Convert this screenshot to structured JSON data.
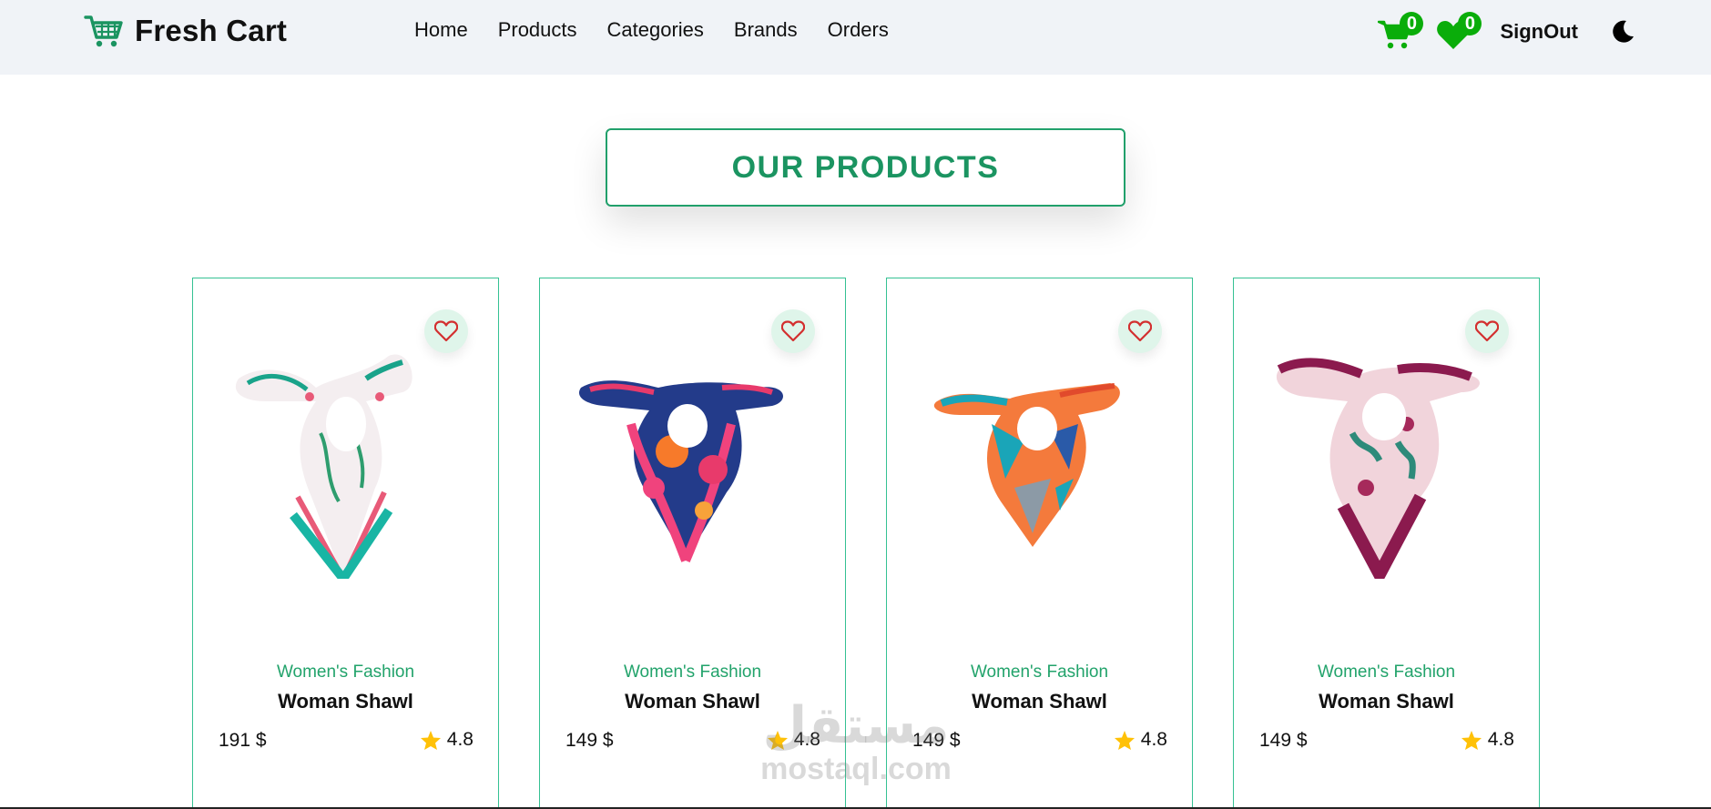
{
  "navbar": {
    "brand": "Fresh Cart",
    "links": [
      "Home",
      "Products",
      "Categories",
      "Brands",
      "Orders"
    ],
    "cart_count": "0",
    "wishlist_count": "0",
    "signout_label": "SignOut"
  },
  "heading": "OUR PRODUCTS",
  "products": [
    {
      "category": "Women's Fashion",
      "name": "Woman Shawl",
      "price": "191 $",
      "rating": "4.8"
    },
    {
      "category": "Women's Fashion",
      "name": "Woman Shawl",
      "price": "149 $",
      "rating": "4.8"
    },
    {
      "category": "Women's Fashion",
      "name": "Woman Shawl",
      "price": "149 $",
      "rating": "4.8"
    },
    {
      "category": "Women's Fashion",
      "name": "Woman Shawl",
      "price": "149 $",
      "rating": "4.8"
    }
  ],
  "watermark": {
    "arabic": "مستقل",
    "latin": "mostaql.com"
  },
  "colors": {
    "accent": "#0aad0a",
    "title": "#1b9461",
    "navbar_bg": "#f0f3f7",
    "category": "#22a36b",
    "star": "#ffc107",
    "heart": "#d32f2f"
  },
  "icons": {
    "brand": "cart-icon",
    "cart": "cart-icon",
    "wishlist": "heart-icon",
    "theme": "moon-icon",
    "rating": "star-icon"
  }
}
